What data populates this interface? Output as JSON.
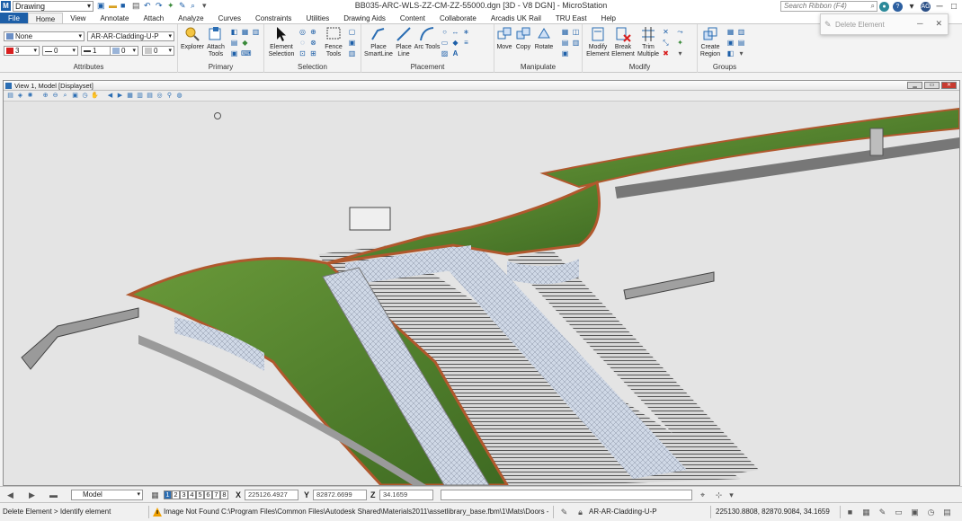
{
  "titlebar": {
    "workspace": "Drawing",
    "document_title": "BB035-ARC-WLS-ZZ-CM-ZZ-55000.dgn [3D - V8 DGN] - MicroStation",
    "search_placeholder": "Search Ribbon (F4)",
    "user_initials": "AG"
  },
  "tabs": [
    "File",
    "Home",
    "View",
    "Annotate",
    "Attach",
    "Analyze",
    "Curves",
    "Constraints",
    "Utilities",
    "Drawing Aids",
    "Content",
    "Collaborate",
    "Arcadis UK Rail",
    "TRU East",
    "Help"
  ],
  "active_tab": "Home",
  "toast": {
    "text": "Delete Element"
  },
  "ribbon": {
    "attributes": {
      "label": "Attributes",
      "level": "None",
      "element_template": "AR-AR-Cladding-U-P",
      "color": "3",
      "style": "0",
      "weight": "1",
      "transparency": "0",
      "priority": "0"
    },
    "primary": {
      "label": "Primary",
      "explorer": "Explorer",
      "attach_tools": "Attach Tools"
    },
    "selection": {
      "label": "Selection",
      "element_selection": "Element Selection",
      "fence_tools": "Fence Tools"
    },
    "placement": {
      "label": "Placement",
      "place_smartline": "Place SmartLine",
      "place_line": "Place Line",
      "arc_tools": "Arc Tools"
    },
    "manipulate": {
      "label": "Manipulate",
      "move": "Move",
      "copy": "Copy",
      "rotate": "Rotate"
    },
    "modify": {
      "label": "Modify",
      "modify_element": "Modify Element",
      "break_element": "Break Element",
      "trim_multiple": "Trim Multiple"
    },
    "groups": {
      "label": "Groups",
      "create_region": "Create Region"
    }
  },
  "view": {
    "title": "View 1, Model [Displayset]"
  },
  "statusbar": {
    "model": "Model",
    "view_numbers": [
      "1",
      "2",
      "3",
      "4",
      "5",
      "6",
      "7",
      "8"
    ],
    "active_view": "1",
    "x_label": "X",
    "x_value": "225126.4927",
    "y_label": "Y",
    "y_value": "82872.6699",
    "z_label": "Z",
    "z_value": "34.1659"
  },
  "messagebar": {
    "prompt": "Delete Element > Identify element",
    "message": "Image Not Found C:\\Program Files\\Common Files\\Autodesk Shared\\Materials2011\\assetlibrary_base.fbm\\1\\Mats\\Doors - Windows.Metal Doors -",
    "active_level": "AR-AR-Cladding-U-P",
    "coordinates": "225130.8808, 82870.9084, 34.1659"
  },
  "colors": {
    "file_tab": "#1d5fa8",
    "roof_green": "#4f7d2a",
    "timber": "#b0582d",
    "viewport_bg": "#e4e4e4"
  }
}
